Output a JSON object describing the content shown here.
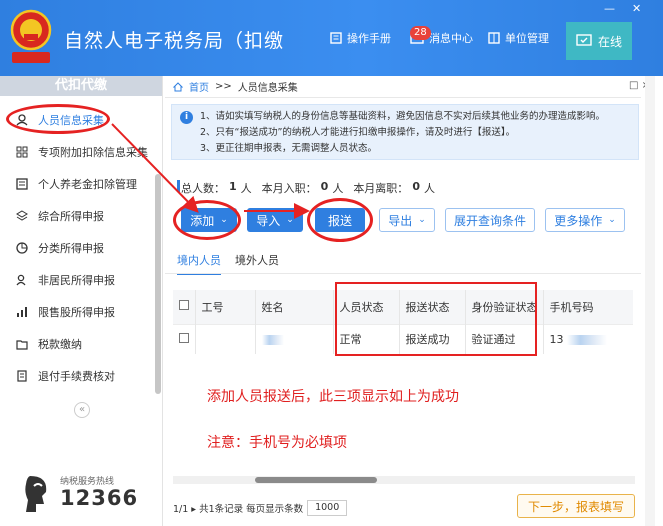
{
  "header": {
    "app_title": "自然人电子税务局（扣缴",
    "nav": [
      {
        "label": "操作手册",
        "icon": "manual-icon"
      },
      {
        "label": "消息中心",
        "icon": "message-icon"
      },
      {
        "label": "单位管理",
        "icon": "building-icon"
      }
    ],
    "message_count": "28",
    "online_label": "在线",
    "min_glyph": "—",
    "close_glyph": "✕"
  },
  "sidebar": {
    "title": "代扣代缴",
    "items": [
      {
        "label": "人员信息采集",
        "icon": "person-icon"
      },
      {
        "label": "专项附加扣除信息采集",
        "icon": "grid-icon"
      },
      {
        "label": "个人养老金扣除管理",
        "icon": "pension-icon"
      },
      {
        "label": "综合所得申报",
        "icon": "layers-icon"
      },
      {
        "label": "分类所得申报",
        "icon": "pie-icon"
      },
      {
        "label": "非居民所得申报",
        "icon": "user-icon"
      },
      {
        "label": "限售股所得申报",
        "icon": "bar-chart-icon"
      },
      {
        "label": "税款缴纳",
        "icon": "folder-icon"
      },
      {
        "label": "退付手续费核对",
        "icon": "clipboard-icon"
      }
    ],
    "collapse_glyph": "«",
    "hotline_label": "纳税服务热线",
    "hotline_number": "12366"
  },
  "breadcrumb": {
    "home": "首页",
    "separator": ">>",
    "current": "人员信息采集",
    "close": "□ ×"
  },
  "notice": {
    "lines": [
      "1、请如实填写纳税人的身份信息等基础资料，避免因信息不实对后续其他业务的办理造成影响。",
      "2、只有“报送成功”的纳税人才能进行扣缴申报操作，请及时进行【报送】。",
      "3、更正往期申报表，无需调整人员状态。"
    ]
  },
  "stats": {
    "total_label": "总人数：",
    "total_value": "1",
    "unit": "人",
    "in_label": "本月入职：",
    "in_value": "0",
    "out_label": "本月离职：",
    "out_value": "0"
  },
  "toolbar": {
    "add": "添加",
    "import": "导入",
    "submit": "报送",
    "export": "导出",
    "expand_filter": "展开查询条件",
    "more": "更多操作"
  },
  "tabs": [
    "境内人员",
    "境外人员"
  ],
  "table": {
    "headers": [
      "工号",
      "姓名",
      "人员状态",
      "报送状态",
      "身份验证状态",
      "手机号码"
    ],
    "rows": [
      {
        "id": "",
        "name": "",
        "status": "正常",
        "submit_status": "报送成功",
        "verify_status": "验证通过",
        "phone": "13"
      }
    ]
  },
  "annotations": {
    "note1": "添加人员报送后，此三项显示如上为成功",
    "note2": "注意：手机号为必填项"
  },
  "pager": {
    "info": "1/1 ▸ 共1条记录  每页显示条数",
    "page_size": "1000",
    "next_button": "下一步，报表填写"
  },
  "colors": {
    "brand_blue": "#2f7fe0",
    "annotation_red": "#e52222",
    "online_teal": "#3fb8c4"
  }
}
